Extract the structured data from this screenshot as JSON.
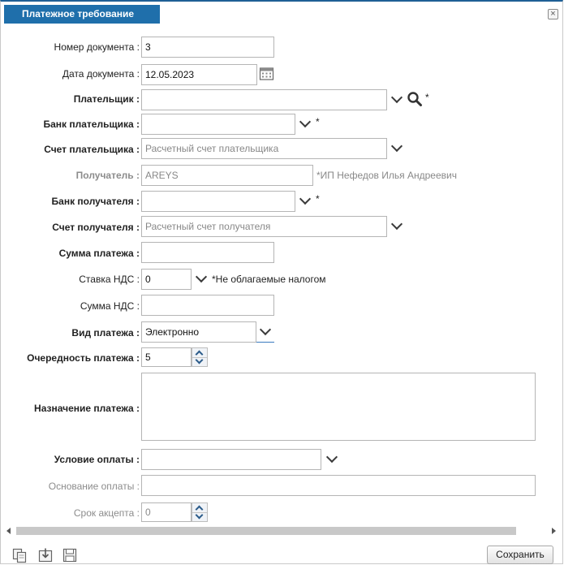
{
  "window": {
    "title": "Платежное требование",
    "close_glyph": "×"
  },
  "fields": {
    "doc_number": {
      "label": "Номер документа :",
      "value": "3"
    },
    "doc_date": {
      "label": "Дата документа :",
      "value": "12.05.2023",
      "icon": "calendar-icon"
    },
    "payer": {
      "label": "Плательщик :",
      "value": "",
      "required_mark": "*"
    },
    "payer_bank": {
      "label": "Банк плательщика :",
      "value": "",
      "required_mark": "*"
    },
    "payer_account": {
      "label": "Счет плательщика :",
      "placeholder": "Расчетный счет плательщика"
    },
    "recipient": {
      "label": "Получатель :",
      "value": "AREYS",
      "note": "*ИП Нефедов Илья Андреевич"
    },
    "recipient_bank": {
      "label": "Банк получателя :",
      "value": "",
      "required_mark": "*"
    },
    "recipient_account": {
      "label": "Счет получателя :",
      "placeholder": "Расчетный счет получателя"
    },
    "payment_sum": {
      "label": "Сумма платежа :",
      "value": ""
    },
    "vat_rate": {
      "label": "Ставка НДС :",
      "value": "0",
      "note": "*Не облагаемые налогом"
    },
    "vat_sum": {
      "label": "Сумма НДС :",
      "value": ""
    },
    "payment_type": {
      "label": "Вид платежа :",
      "value": "Электронно"
    },
    "payment_priority": {
      "label": "Очередность платежа :",
      "value": "5"
    },
    "payment_purpose": {
      "label": "Назначение платежа :",
      "value": ""
    },
    "payment_condition": {
      "label": "Условие оплаты :",
      "value": ""
    },
    "payment_basis": {
      "label": "Основание оплаты :",
      "value": ""
    },
    "acceptance_term": {
      "label": "Срок акцепта :",
      "value": "0"
    }
  },
  "footer": {
    "icons": [
      "copy-icon",
      "import-icon",
      "save-disk-icon"
    ],
    "save_label": "Сохранить"
  },
  "colors": {
    "title_bg": "#1f6fab",
    "title_text": "#ffffff"
  }
}
